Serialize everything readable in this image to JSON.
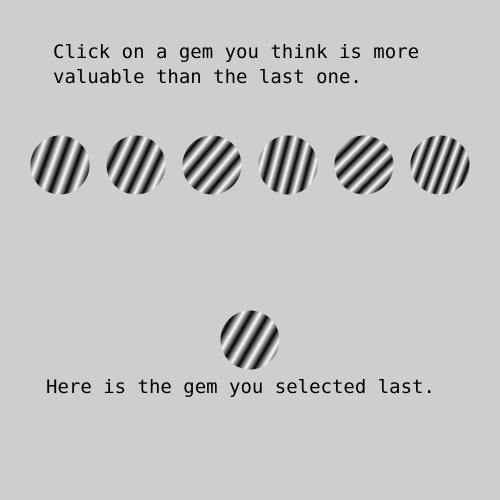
{
  "instruction": {
    "line1": "Click on a gem you think is more",
    "line2": "valuable than the last one."
  },
  "gems": [
    {
      "icon": "striped-gem-icon",
      "stripe_angle_deg": 20,
      "stripe_period": 15,
      "phase": 0.0
    },
    {
      "icon": "striped-gem-icon",
      "stripe_angle_deg": 25,
      "stripe_period": 14,
      "phase": 0.3
    },
    {
      "icon": "striped-gem-icon",
      "stripe_angle_deg": 40,
      "stripe_period": 14,
      "phase": 0.1
    },
    {
      "icon": "striped-gem-icon",
      "stripe_angle_deg": 15,
      "stripe_period": 13,
      "phase": 0.5
    },
    {
      "icon": "striped-gem-icon",
      "stripe_angle_deg": 45,
      "stripe_period": 13,
      "phase": 0.2
    },
    {
      "icon": "striped-gem-icon",
      "stripe_angle_deg": 20,
      "stripe_period": 11,
      "phase": 0.4
    }
  ],
  "selected_gem": {
    "icon": "striped-gem-icon",
    "stripe_angle_deg": 30,
    "stripe_period": 15,
    "phase": 0.2
  },
  "caption": "Here is the gem you selected last.",
  "colors": {
    "background": "#cecece",
    "stripe_dark": "#000000",
    "stripe_light": "#ffffff"
  }
}
